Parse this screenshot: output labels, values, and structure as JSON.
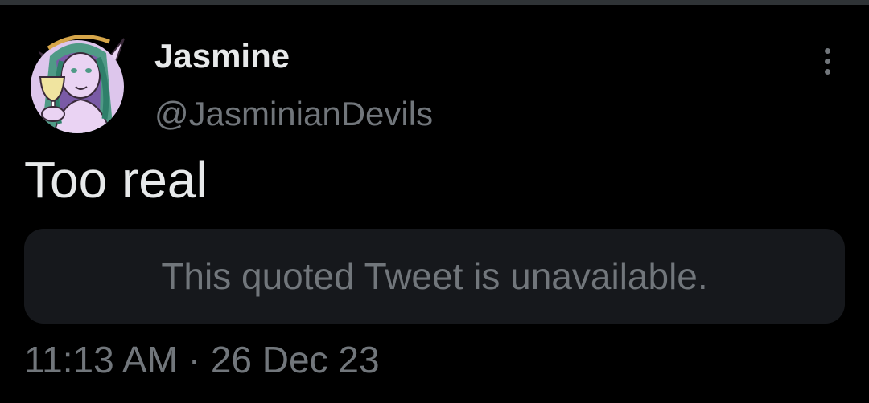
{
  "author": {
    "name": "Jasmine",
    "handle": "@JasminianDevils",
    "avatar_icon": "avatar-illustration-icon"
  },
  "tweet": {
    "text": "Too real",
    "quoted_notice": "This quoted Tweet is unavailable.",
    "time": "11:13 AM",
    "separator": "·",
    "date": "26 Dec 23"
  },
  "icons": {
    "more": "more-options-icon"
  },
  "colors": {
    "background": "#000000",
    "primary_text": "#e7e9ea",
    "secondary_text": "#71767b",
    "card_background": "#16181c",
    "divider": "#2f3336",
    "avatar_background": "#ddc6ec"
  }
}
